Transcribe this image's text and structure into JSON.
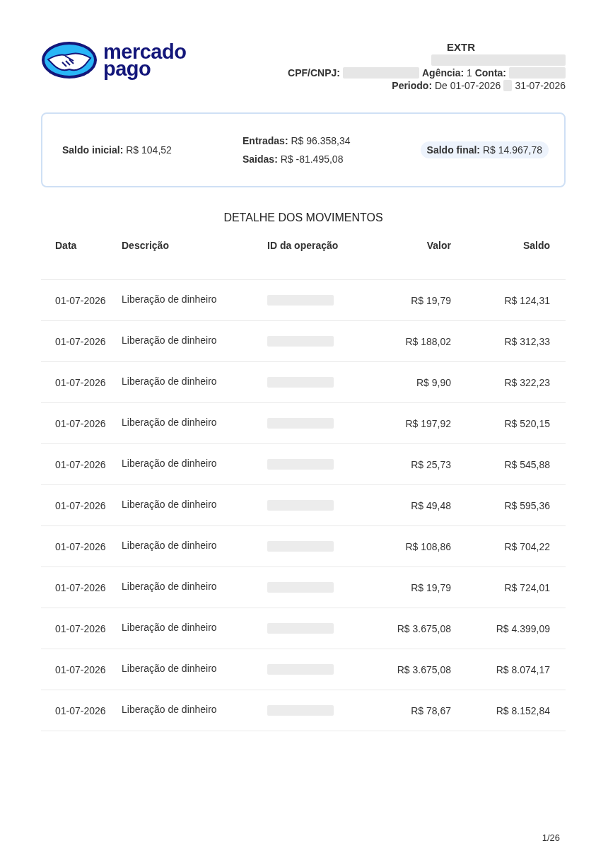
{
  "logo": {
    "text_line_1": "mercado",
    "text_line_2": "pago"
  },
  "header": {
    "title": "EXTR",
    "cpf_label": "CPF/CNPJ:",
    "agencia_label": "Agência:",
    "agencia_value": "1",
    "conta_label": "Conta:",
    "periodo_label": "Periodo:",
    "periodo_from": "De 01-07-2026",
    "periodo_to": "31-07-2026"
  },
  "summary": {
    "saldo_inicial_label": "Saldo inicial:",
    "saldo_inicial": "R$ 104,52",
    "entradas_label": "Entradas:",
    "entradas": "R$ 96.358,34",
    "saidas_label": "Saidas:",
    "saidas": "R$ -81.495,08",
    "saldo_final_label": "Saldo final:",
    "saldo_final": "R$ 14.967,78"
  },
  "section_title": "DETALHE DOS MOVIMENTOS",
  "table": {
    "columns": [
      "Data",
      "Descrição",
      "ID da operação",
      "Valor",
      "Saldo"
    ],
    "rows": [
      {
        "data": "01-07-2026",
        "descricao": "Liberação de dinheiro",
        "valor": "R$ 19,79",
        "saldo": "R$ 124,31"
      },
      {
        "data": "01-07-2026",
        "descricao": "Liberação de dinheiro",
        "valor": "R$ 188,02",
        "saldo": "R$ 312,33"
      },
      {
        "data": "01-07-2026",
        "descricao": "Liberação de dinheiro",
        "valor": "R$ 9,90",
        "saldo": "R$ 322,23"
      },
      {
        "data": "01-07-2026",
        "descricao": "Liberação de dinheiro",
        "valor": "R$ 197,92",
        "saldo": "R$ 520,15"
      },
      {
        "data": "01-07-2026",
        "descricao": "Liberação de dinheiro",
        "valor": "R$ 25,73",
        "saldo": "R$ 545,88"
      },
      {
        "data": "01-07-2026",
        "descricao": "Liberação de dinheiro",
        "valor": "R$ 49,48",
        "saldo": "R$ 595,36"
      },
      {
        "data": "01-07-2026",
        "descricao": "Liberação de dinheiro",
        "valor": "R$ 108,86",
        "saldo": "R$ 704,22"
      },
      {
        "data": "01-07-2026",
        "descricao": "Liberação de dinheiro",
        "valor": "R$ 19,79",
        "saldo": "R$ 724,01"
      },
      {
        "data": "01-07-2026",
        "descricao": "Liberação de dinheiro",
        "valor": "R$ 3.675,08",
        "saldo": "R$ 4.399,09"
      },
      {
        "data": "01-07-2026",
        "descricao": "Liberação de dinheiro",
        "valor": "R$ 3.675,08",
        "saldo": "R$ 8.074,17"
      },
      {
        "data": "01-07-2026",
        "descricao": "Liberação de dinheiro",
        "valor": "R$ 78,67",
        "saldo": "R$ 8.152,84"
      }
    ]
  },
  "page_number": "1/26"
}
